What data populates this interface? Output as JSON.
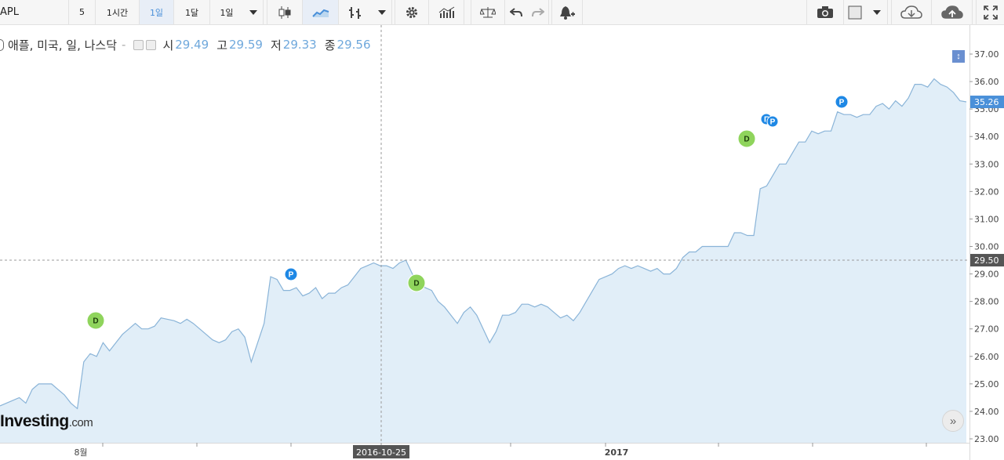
{
  "toolbar": {
    "symbol": "APL",
    "intervals": [
      "5",
      "1시간",
      "1일",
      "1달",
      "1일"
    ],
    "active_interval": "1일",
    "icons": [
      "chevron-down-icon",
      "candlestick-icon",
      "area-chart-icon",
      "bar-chart-icon",
      "chevron-down-icon",
      "gear-icon",
      "indicators-icon",
      "balance-icon",
      "undo-icon",
      "redo-icon",
      "alert-bell-icon",
      "camera-icon",
      "color-box-icon",
      "chevron-down-icon",
      "cloud-download-icon",
      "cloud-upload-icon",
      "fullscreen-icon"
    ]
  },
  "legend": {
    "title": "애플, 미국, 일, 나스닥",
    "dash": "-",
    "open_label": "시",
    "open": "29.49",
    "high_label": "고",
    "high": "29.59",
    "low_label": "저",
    "low": "29.33",
    "close_label": "종",
    "close": "29.56"
  },
  "crosshair": {
    "price": "29.50",
    "date": "2016-10-25"
  },
  "last_price": "35.26",
  "brand": {
    "name": "Investing",
    "suffix": ".com"
  },
  "colors": {
    "line": "#8ab4d8",
    "fill": "#e1eef8",
    "accent": "#4a90d9",
    "dividend": "#8fd45c",
    "split": "#1e88e5"
  },
  "chart_data": {
    "type": "area",
    "y_ticks": [
      "37.00",
      "36.00",
      "35.00",
      "34.00",
      "33.00",
      "32.00",
      "31.00",
      "30.00",
      "29.00",
      "28.00",
      "27.00",
      "26.00",
      "25.00",
      "24.00",
      "23.00"
    ],
    "ylim": [
      22.8,
      37.6
    ],
    "x_ticks": [
      "8월",
      "2016-10-25",
      "2017"
    ],
    "grid": false,
    "series": [
      {
        "values": [
          24.2,
          24.3,
          24.4,
          24.5,
          24.3,
          24.8,
          25.0,
          25.0,
          25.0,
          24.8,
          24.6,
          24.3,
          24.1,
          25.8,
          26.1,
          26.0,
          26.5,
          26.2,
          26.5,
          26.8,
          27.0,
          27.2,
          27.0,
          27.0,
          27.1,
          27.4,
          27.35,
          27.3,
          27.2,
          27.35,
          27.2,
          27.0,
          26.8,
          26.6,
          26.5,
          26.6,
          26.9,
          27.0,
          26.7,
          25.8,
          26.5,
          27.2,
          28.9,
          28.8,
          28.4,
          28.4,
          28.5,
          28.2,
          28.3,
          28.5,
          28.1,
          28.3,
          28.3,
          28.5,
          28.6,
          28.9,
          29.2,
          29.3,
          29.4,
          29.3,
          29.3,
          29.2,
          29.4,
          29.5,
          29.0,
          28.7,
          28.5,
          28.4,
          28.0,
          27.8,
          27.5,
          27.2,
          27.6,
          27.8,
          27.5,
          27.0,
          26.5,
          26.9,
          27.5,
          27.5,
          27.6,
          27.9,
          27.9,
          27.8,
          27.9,
          27.8,
          27.6,
          27.4,
          27.5,
          27.3,
          27.6,
          28.0,
          28.4,
          28.8,
          28.9,
          29.0,
          29.2,
          29.3,
          29.2,
          29.3,
          29.2,
          29.1,
          29.2,
          29.0,
          29.0,
          29.2,
          29.6,
          29.8,
          29.8,
          30.0,
          30.0,
          30.0,
          30.0,
          30.0,
          30.5,
          30.5,
          30.4,
          30.4,
          32.1,
          32.2,
          32.6,
          33.0,
          33.0,
          33.4,
          33.8,
          33.8,
          34.2,
          34.1,
          34.2,
          34.2,
          34.9,
          34.8,
          34.8,
          34.7,
          34.8,
          34.8,
          35.1,
          35.2,
          35.0,
          35.3,
          35.1,
          35.4,
          35.9,
          35.9,
          35.8,
          36.1,
          35.9,
          35.8,
          35.6,
          35.3,
          35.26
        ]
      }
    ],
    "events": [
      {
        "type": "dividend",
        "label": "D"
      },
      {
        "type": "split",
        "label": "P"
      },
      {
        "type": "dividend",
        "label": "D"
      },
      {
        "type": "dividend",
        "label": "D"
      },
      {
        "type": "split",
        "label": "Γ"
      },
      {
        "type": "split",
        "label": "P"
      },
      {
        "type": "split",
        "label": "P"
      }
    ]
  }
}
